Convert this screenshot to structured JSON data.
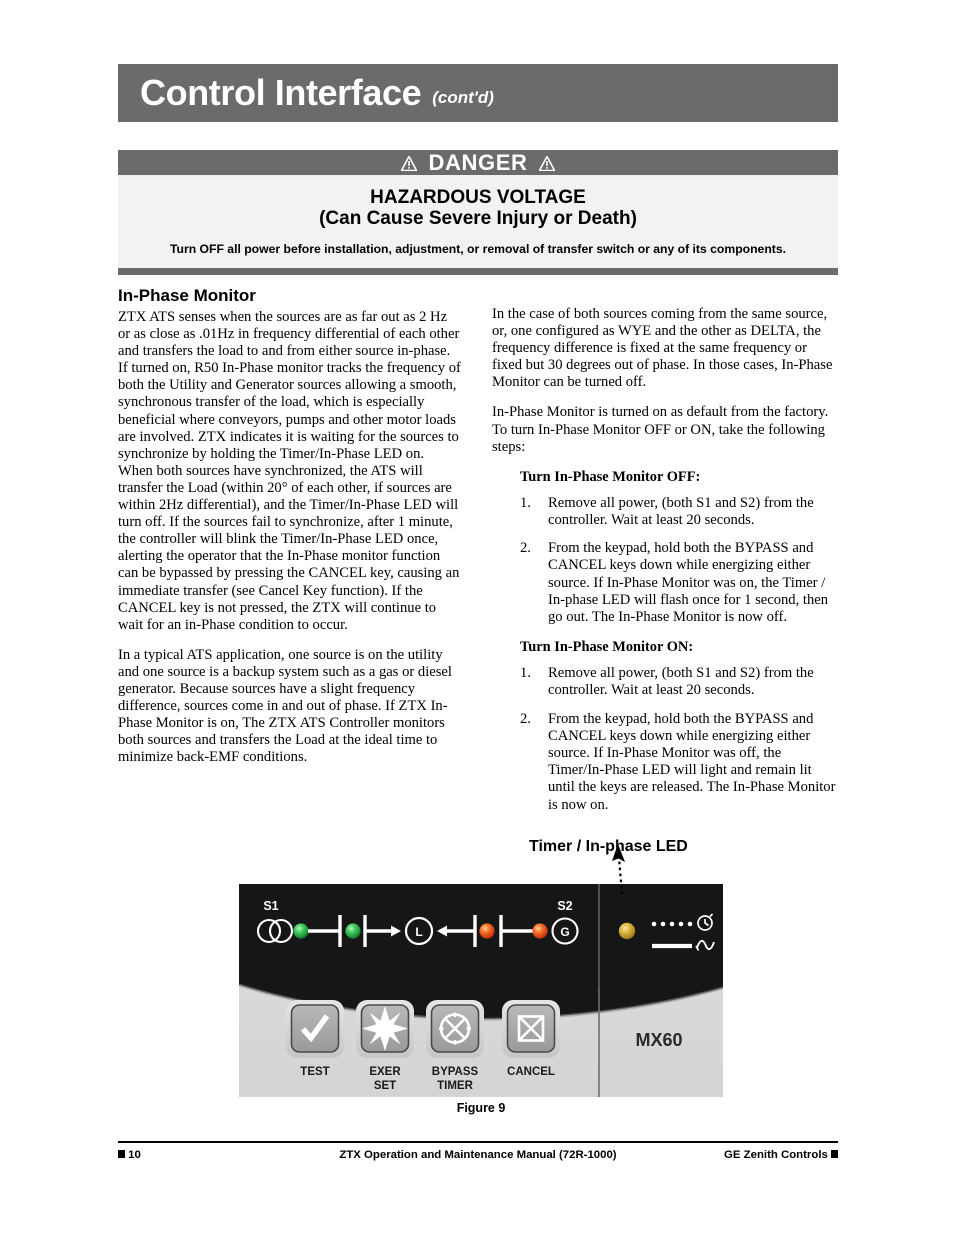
{
  "header": {
    "title": "Control Interface",
    "cont": "(cont'd)"
  },
  "danger": {
    "label": "DANGER",
    "heading_line1": "HAZARDOUS VOLTAGE",
    "heading_line2": "(Can Cause Severe Injury or Death)",
    "note": "Turn OFF all power before installation, adjustment, or removal of transfer switch or any of its components.",
    "bar_color": "#6b6b6b",
    "body_color": "#f2f2f2"
  },
  "left_column": {
    "section_title": "In-Phase Monitor",
    "paragraphs": [
      "ZTX ATS senses when the sources are as far out as 2 Hz or as close as .01Hz in frequency differential of each other and transfers the load to and from either source in-phase.  If turned on, R50 In-Phase monitor tracks the frequency of both the Utility and Generator sources allowing a smooth, synchronous transfer of the load, which is especially beneficial where conveyors, pumps and other motor loads are involved.  ZTX indicates it is waiting for the sources to synchronize by holding the Timer/In-Phase LED on.  When both sources have synchronized, the ATS will transfer the Load (within 20° of each other, if sources are within 2Hz differential), and the Timer/In-Phase LED will turn off.  If the sources fail to synchronize, after 1 minute, the controller will blink the Timer/In-Phase LED once, alerting the operator that the In-Phase monitor function can be bypassed by pressing the CANCEL key, causing an immediate transfer (see Cancel Key  function).  If the CANCEL key is not pressed, the ZTX will continue to wait for an in-Phase condition to occur.",
      "In a typical ATS application, one source is on the utility and one source is a backup system such as a gas or diesel generator.  Because sources have a slight frequency difference, sources come in and out of phase. If ZTX In-Phase Monitor is on, The ZTX ATS Controller monitors both sources and transfers the Load at the ideal time to minimize back-EMF conditions."
    ]
  },
  "right_column": {
    "paragraphs": [
      "In the case of both sources coming from the same source, or, one configured as WYE and the other as DELTA, the frequency difference is fixed at the same frequency or fixed but 30 degrees out of phase. In those cases, In-Phase Monitor can be turned off.",
      "In-Phase Monitor is turned on as default from the factory. To turn In-Phase Monitor OFF or ON, take the following steps:"
    ],
    "off_heading": "Turn In-Phase Monitor OFF:",
    "off_steps": [
      {
        "num": "1.",
        "text": "Remove all power, (both S1 and S2) from the controller. Wait at least 20 seconds."
      },
      {
        "num": "2.",
        "text": "From the keypad, hold both the BYPASS and CANCEL keys down while energizing either source.  If In-Phase Monitor was on, the Timer / In-phase LED will flash once for 1 second, then go out.  The In-Phase Monitor is now off."
      }
    ],
    "on_heading": "Turn In-Phase Monitor ON:",
    "on_steps": [
      {
        "num": "1.",
        "text": "Remove all power, (both S1 and S2) from the controller. Wait at least 20 seconds."
      },
      {
        "num": "2.",
        "text": "From the keypad, hold both the BYPASS and CANCEL keys down while energizing either source.  If In-Phase Monitor was off, the Timer/In-Phase LED will light and remain lit until the keys are released. The In-Phase Monitor is now on."
      }
    ]
  },
  "figure": {
    "callout_label": "Timer / In-phase LED",
    "caption": "Figure 9",
    "panel": {
      "model": "MX60",
      "source1_label": "S1",
      "source2_label": "S2",
      "load_label": "L",
      "gen_label": "G",
      "leds": [
        {
          "name": "s1-closed-led",
          "color": "#2fbd4f"
        },
        {
          "name": "s1-available-led",
          "color": "#2fbd4f"
        },
        {
          "name": "s2-available-led",
          "color": "#ef5223"
        },
        {
          "name": "s2-closed-led",
          "color": "#ef5223"
        },
        {
          "name": "timer-inphase-led",
          "color": "#d9b13a"
        }
      ],
      "buttons": [
        {
          "label_line1": "TEST",
          "label_line2": "",
          "icon": "check-icon"
        },
        {
          "label_line1": "EXER",
          "label_line2": "SET",
          "icon": "starburst-icon"
        },
        {
          "label_line1": "BYPASS",
          "label_line2": "TIMER",
          "icon": "bypass-timer-icon"
        },
        {
          "label_line1": "CANCEL",
          "label_line2": "",
          "icon": "cancel-x-icon"
        }
      ],
      "legend": [
        {
          "icon": "clock-icon",
          "line_style": "dotted"
        },
        {
          "icon": "sine-wave-icon",
          "line_style": "solid"
        }
      ]
    }
  },
  "footer": {
    "page_number": "10",
    "manual": "ZTX Operation and Maintenance Manual (72R-1000)",
    "company": "GE Zenith Controls"
  }
}
